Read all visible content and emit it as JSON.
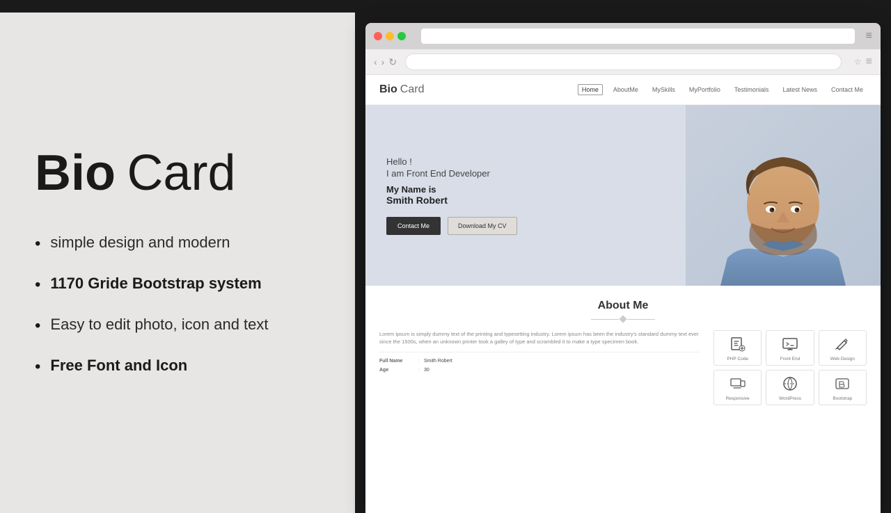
{
  "left": {
    "title_bold": "Bio",
    "title_light": "Card",
    "features": [
      {
        "id": "f1",
        "text": "simple design and modern",
        "bold": false
      },
      {
        "id": "f2",
        "text": "1170 Gride Bootstrap system",
        "bold": true
      },
      {
        "id": "f3",
        "text": "Easy to edit photo, icon and text",
        "bold": false
      },
      {
        "id": "f4",
        "text": "Free Font and Icon",
        "bold": true
      }
    ]
  },
  "browser": {
    "nav": {
      "back": "‹",
      "forward": "›",
      "refresh": "↻"
    },
    "site": {
      "logo_bold": "Bio",
      "logo_light": "Card",
      "menu_items": [
        "Home",
        "AboutMe",
        "MySkills",
        "MyPortfolio",
        "Testimonials",
        "Latest News",
        "Contact Me"
      ],
      "active_item": "Home",
      "hero": {
        "greeting": "Hello !",
        "role": "I am Front End Developer",
        "name_label": "My Name is",
        "name": "Smith Robert",
        "btn_contact": "Contact Me",
        "btn_download": "Download My CV"
      },
      "about": {
        "title": "About Me",
        "body": "Lorem ipsum is simply dummy text of the printing and typesetting industry. Lorem ipsum has been the industry's standard dummy text ever since the 1500s, when an unknown printer took a galley of type and scrambled it to make a type specimen book.",
        "info_rows": [
          {
            "label": "Full Name",
            "value": "Smith Robert"
          },
          {
            "label": "Age",
            "value": "30"
          }
        ]
      },
      "skills": [
        {
          "icon": "📄",
          "label": "PHP Code"
        },
        {
          "icon": "🖥",
          "label": "Front End"
        },
        {
          "icon": "✏",
          "label": "Web Design"
        },
        {
          "icon": "📋",
          "label": "Responsive"
        },
        {
          "icon": "🌐",
          "label": "WordPress"
        },
        {
          "icon": "⚙",
          "label": "Bootstrap"
        }
      ]
    }
  }
}
